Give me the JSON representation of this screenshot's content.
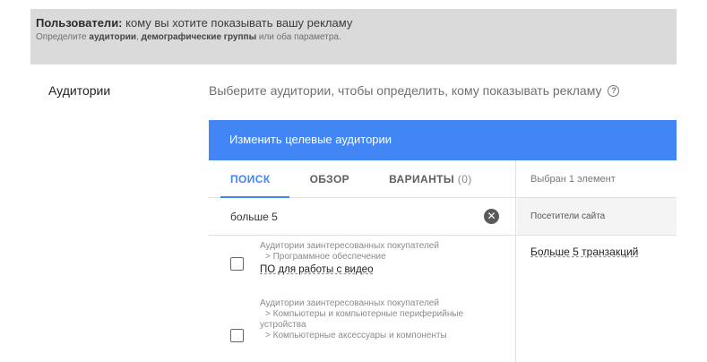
{
  "banner": {
    "title_bold": "Пользователи:",
    "title_rest": " кому вы хотите показывать вашу рекламу",
    "sub_prefix": "Определите ",
    "sub_bold1": "аудитории",
    "sub_sep": ", ",
    "sub_bold2": "демографические группы",
    "sub_suffix": " или оба параметра."
  },
  "audiences": {
    "label": "Аудитории",
    "description": "Выберите аудитории, чтобы определить, кому показывать рекламу",
    "help_glyph": "?"
  },
  "panel": {
    "header": "Изменить целевые аудитории",
    "tabs": [
      {
        "label": "ПОИСК",
        "active": true
      },
      {
        "label": "ОБЗОР",
        "active": false
      },
      {
        "label": "ВАРИАНТЫ",
        "count": "(0)",
        "active": false
      }
    ],
    "search": {
      "value": "больше 5",
      "clear_glyph": "✕"
    },
    "results": [
      {
        "path": [
          "Аудитории заинтересованных покупателей",
          "> Программное обеспечение"
        ],
        "name": "ПО для работы с видео",
        "checked": false
      },
      {
        "path": [
          "Аудитории заинтересованных покупателей",
          "> Компьютеры и компьютерные периферийные",
          "устройства",
          "> Компьютерные аксессуары и компоненты"
        ],
        "name": "",
        "checked": false
      }
    ],
    "selected": {
      "header": "Выбран 1 элемент",
      "group": "Посетители сайта",
      "items": [
        "Больше 5 транзакций"
      ]
    }
  },
  "colors": {
    "accent": "#4285f4",
    "banner_bg": "#dadada"
  }
}
